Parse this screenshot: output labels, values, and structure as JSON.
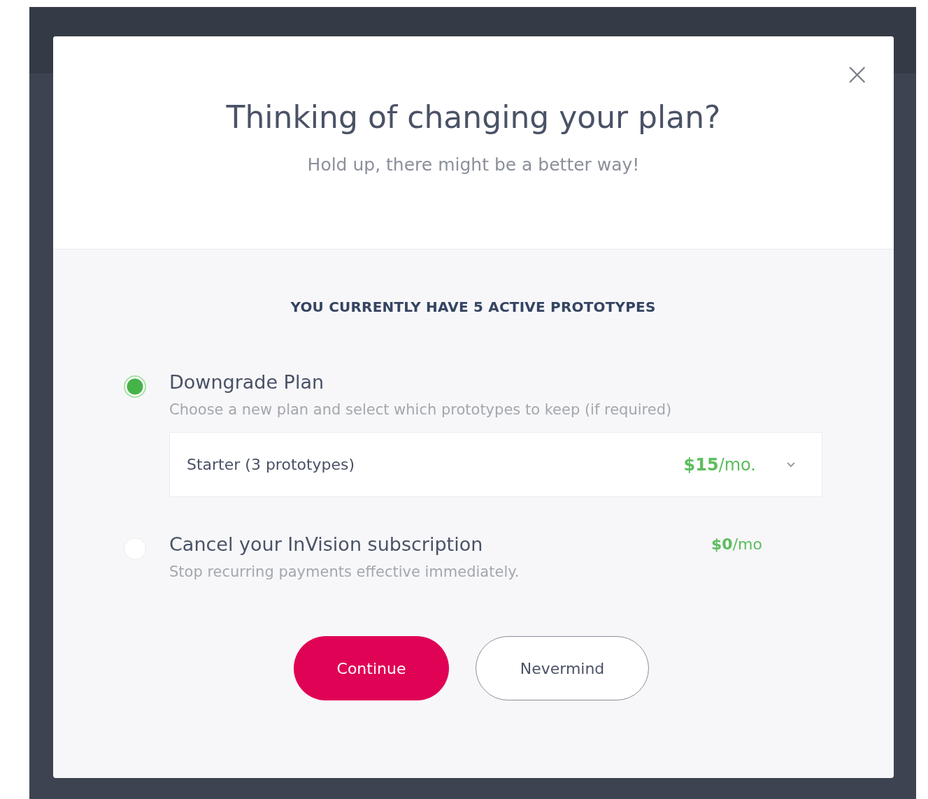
{
  "dialog": {
    "title": "Thinking of changing your plan?",
    "subtitle": "Hold up, there might be a better way!",
    "close": "×",
    "heading": "YOU CURRENTLY HAVE 5 ACTIVE PROTOTYPES",
    "options": [
      {
        "title": "Downgrade Plan",
        "description": "Choose a new plan and select which prototypes to keep (if required)",
        "selected": true,
        "dropdown": {
          "value": "Starter (3 prototypes)",
          "price": "**$15**/mo."
        }
      },
      {
        "title": "Cancel your InVision subscription",
        "description": "Stop recurring payments effective immediately.",
        "selected": false,
        "price": "**$0**/mo"
      }
    ],
    "buttons": [
      {
        "label": "Continue",
        "kind": "primary"
      },
      {
        "label": "Nevermind",
        "kind": "secondary"
      }
    ]
  }
}
